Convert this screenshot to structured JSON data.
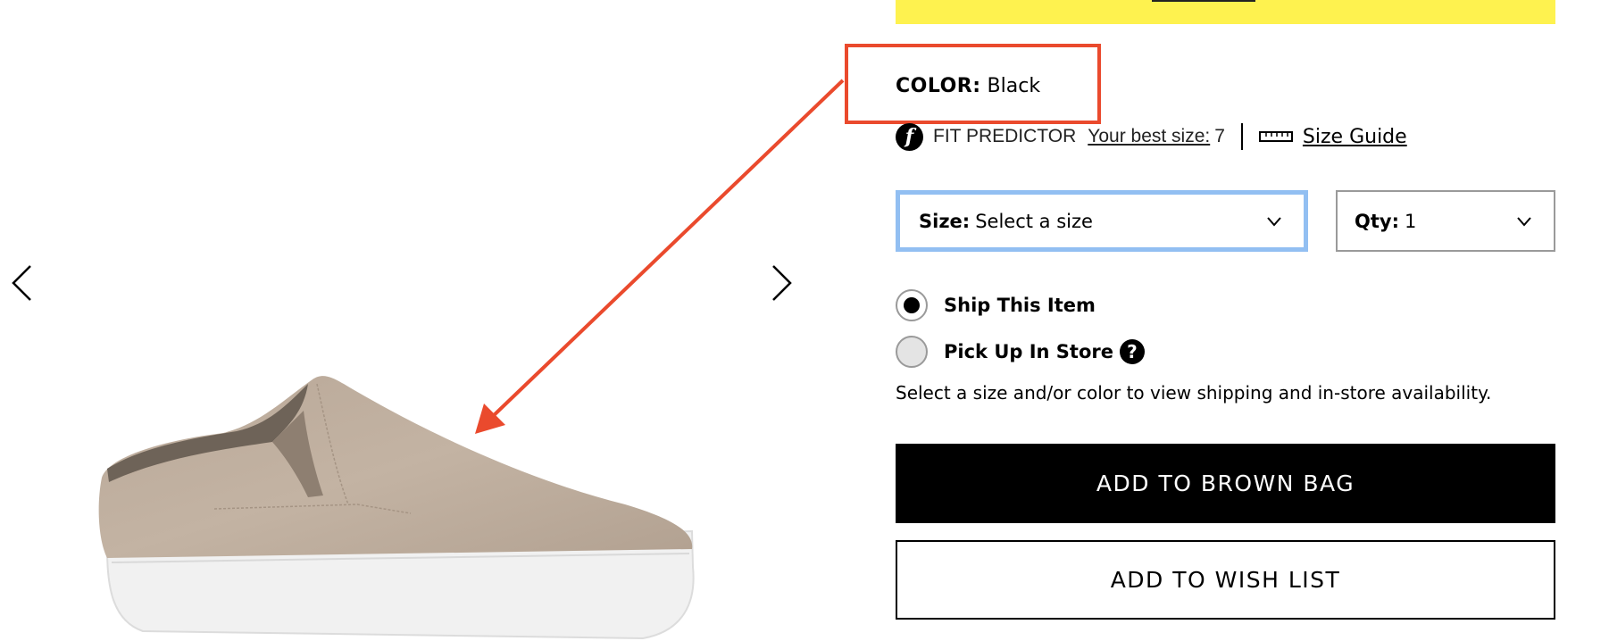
{
  "promo": {
    "bar_color": "#fef24f"
  },
  "carousel": {
    "prev_icon": "chevron-left-icon",
    "next_icon": "chevron-right-icon",
    "image_alt": "Taupe suede slip-on mule sneaker with white platform sole"
  },
  "annotation": {
    "color": "#ea4a2d"
  },
  "color": {
    "label": "COLOR:",
    "value": "Black"
  },
  "fit_predictor": {
    "icon": "f",
    "label": "FIT PREDICTOR",
    "best_size_label": "Your best size:",
    "best_size_value": "7",
    "size_guide_label": "Size Guide"
  },
  "size_select": {
    "label": "Size:",
    "value": "Select a size"
  },
  "qty_select": {
    "label": "Qty:",
    "value": "1"
  },
  "fulfillment": {
    "options": [
      {
        "label": "Ship This Item",
        "selected": true
      },
      {
        "label": "Pick Up In Store",
        "selected": false
      }
    ],
    "help_icon": "?"
  },
  "availability_note": "Select a size and/or color to view shipping and in-store availability.",
  "buttons": {
    "add_to_bag": "ADD TO BROWN BAG",
    "add_to_wish_list": "ADD TO WISH LIST"
  }
}
